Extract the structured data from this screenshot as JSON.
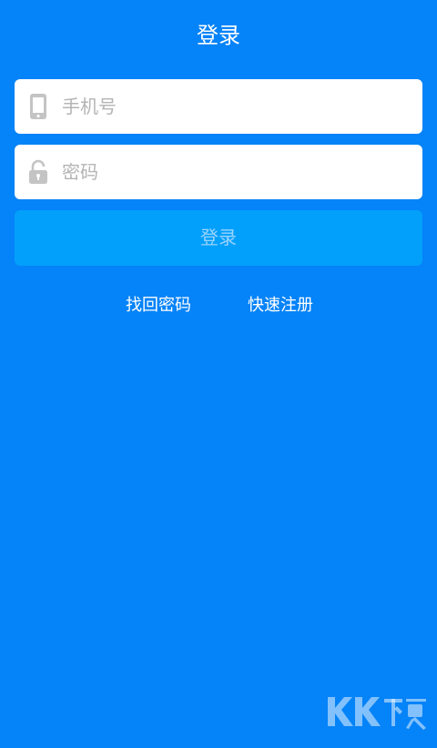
{
  "header": {
    "title": "登录"
  },
  "form": {
    "phone": {
      "icon": "phone-icon",
      "placeholder": "手机号",
      "value": ""
    },
    "password": {
      "icon": "lock-icon",
      "placeholder": "密码",
      "value": ""
    },
    "login_label": "登录"
  },
  "links": {
    "forgot_password": "找回密码",
    "quick_register": "快速注册"
  },
  "watermark": {
    "icon": "kk-download-watermark-logo",
    "text": "KK下载"
  },
  "colors": {
    "background": "#0583f8",
    "field_background": "#ffffff",
    "login_button": "#03a0fb",
    "login_text": "#9bd3ff",
    "placeholder": "#b4b4b4",
    "icon_gray": "#c4c4c4"
  }
}
